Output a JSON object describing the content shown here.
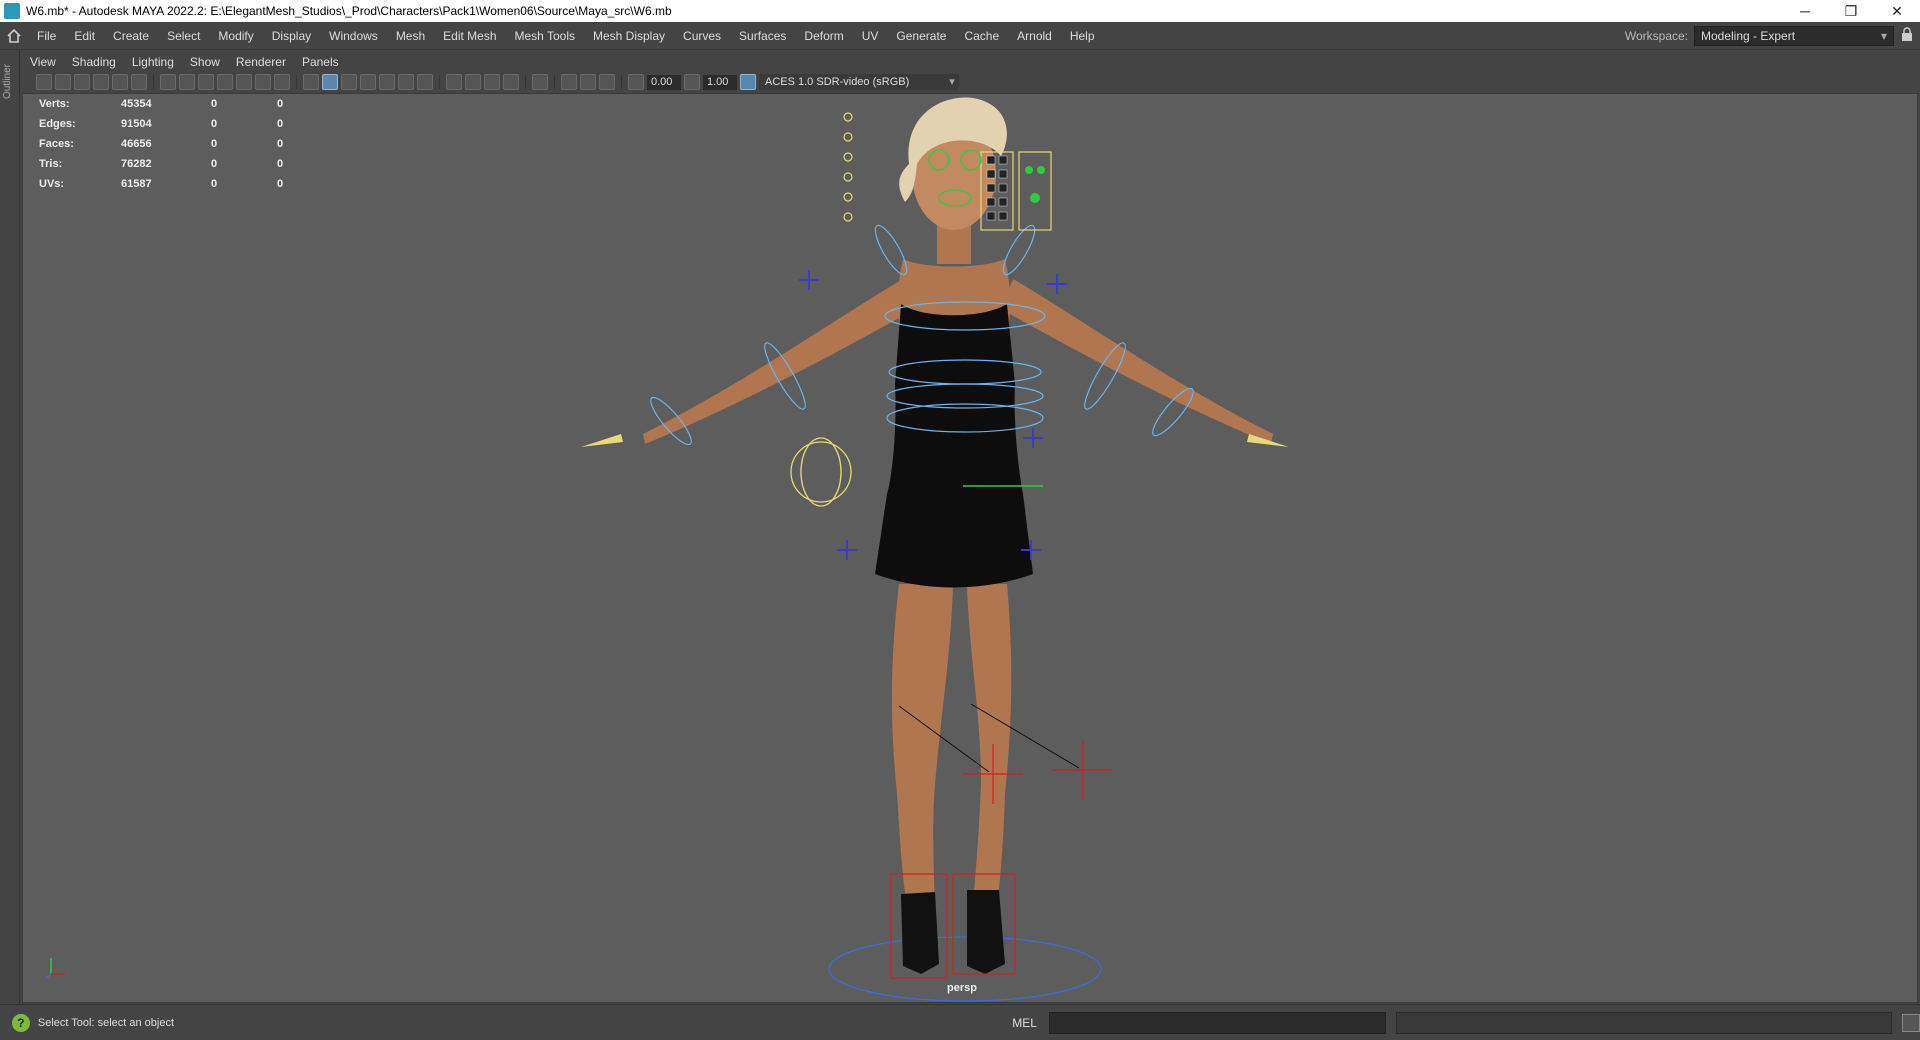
{
  "window": {
    "title": "W6.mb* - Autodesk MAYA 2022.2: E:\\ElegantMesh_Studios\\_Prod\\Characters\\Pack1\\Women06\\Source\\Maya_src\\W6.mb",
    "minimize": "─",
    "restore": "❐",
    "close": "✕"
  },
  "menubar": {
    "items": [
      "File",
      "Edit",
      "Create",
      "Select",
      "Modify",
      "Display",
      "Windows",
      "Mesh",
      "Edit Mesh",
      "Mesh Tools",
      "Mesh Display",
      "Curves",
      "Surfaces",
      "Deform",
      "UV",
      "Generate",
      "Cache",
      "Arnold",
      "Help"
    ],
    "workspace_label": "Workspace:",
    "workspace_value": "Modeling - Expert"
  },
  "outliner_label": "Outliner",
  "panel_menu": [
    "View",
    "Shading",
    "Lighting",
    "Show",
    "Renderer",
    "Panels"
  ],
  "panel_toolbar": {
    "exposure": "0.00",
    "gamma": "1.00",
    "color_management": "ACES 1.0 SDR-video (sRGB)"
  },
  "hud": {
    "rows": [
      {
        "label": "Verts:",
        "value": "45354",
        "a": "0",
        "b": "0"
      },
      {
        "label": "Edges:",
        "value": "91504",
        "a": "0",
        "b": "0"
      },
      {
        "label": "Faces:",
        "value": "46656",
        "a": "0",
        "b": "0"
      },
      {
        "label": "Tris:",
        "value": "76282",
        "a": "0",
        "b": "0"
      },
      {
        "label": "UVs:",
        "value": "61587",
        "a": "0",
        "b": "0"
      }
    ]
  },
  "viewport": {
    "camera": "persp"
  },
  "statusbar": {
    "help_text": "Select Tool: select an object",
    "mel_label": "MEL"
  }
}
